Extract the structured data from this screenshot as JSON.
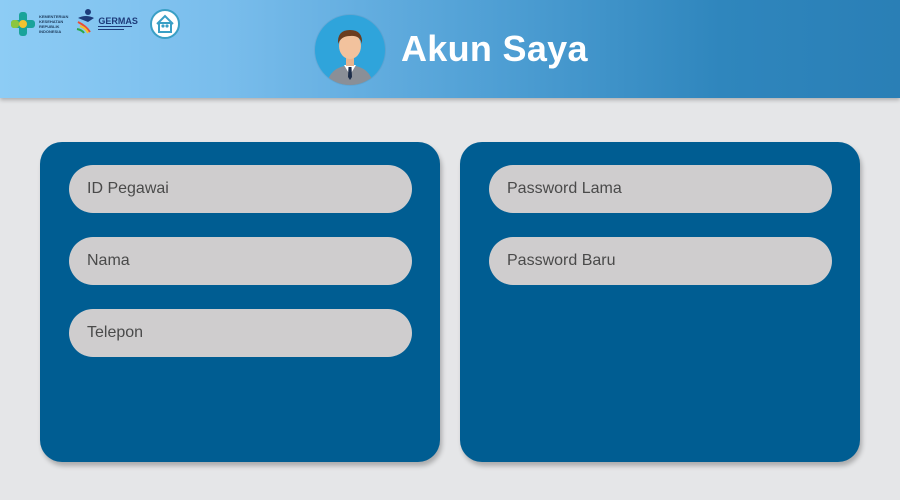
{
  "header": {
    "title": "Akun Saya",
    "logos": {
      "kemenkes_lines": [
        "KEMENTERIAN",
        "KESEHATAN",
        "REPUBLIK",
        "INDONESIA"
      ],
      "germas_word": "GERMAS"
    }
  },
  "profile_form": {
    "employee_id_placeholder": "ID Pegawai",
    "name_placeholder": "Nama",
    "phone_placeholder": "Telepon"
  },
  "password_form": {
    "old_password_placeholder": "Password Lama",
    "new_password_placeholder": "Password Baru"
  },
  "colors": {
    "card": "#005d92",
    "field": "#cfcdce",
    "background": "#e5e6e8",
    "avatar_bg": "#2fa4db"
  }
}
